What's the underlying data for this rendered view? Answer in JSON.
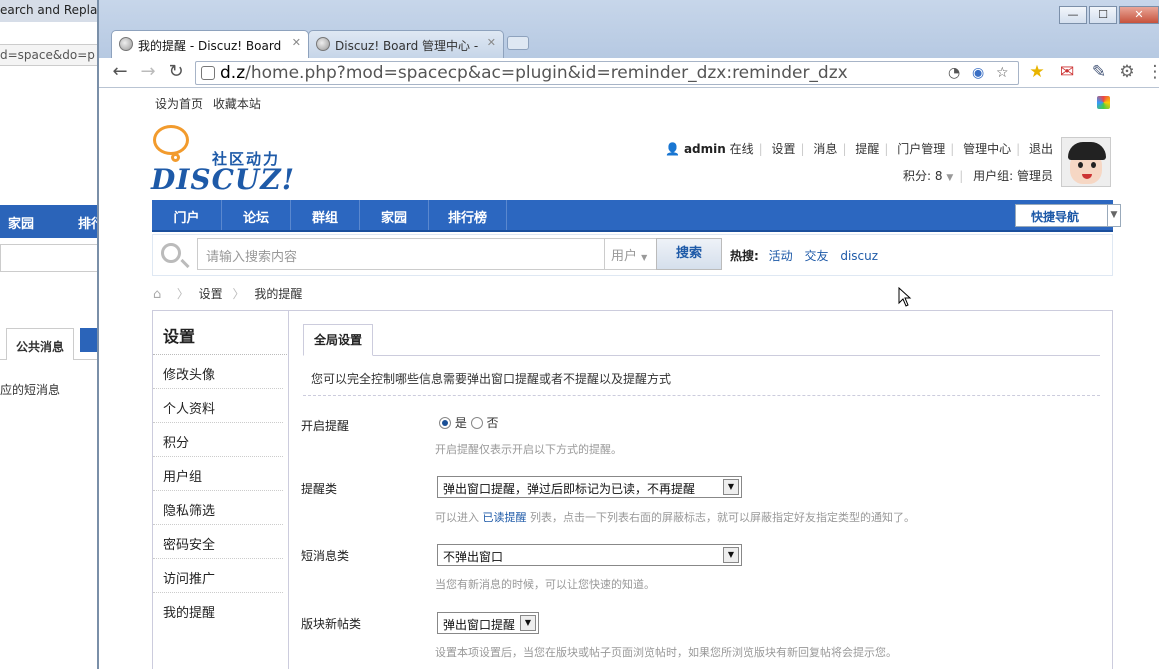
{
  "background_window": {
    "title": "earch and Replac",
    "url": "d=space&do=p",
    "nav_items": [
      "家园",
      "排行"
    ],
    "tab_label": "公共消息",
    "body_text": "应的短消息"
  },
  "browser": {
    "tabs": [
      {
        "label": "我的提醒 - Discuz! Board",
        "close": "✕"
      },
      {
        "label": "Discuz! Board 管理中心 -",
        "close": "✕"
      }
    ],
    "url_host": "d.z",
    "url_path": "/home.php?mod=spacecp&ac=plugin&id=reminder_dzx:reminder_dzx",
    "window_controls": [
      "—",
      "☐",
      "✕"
    ]
  },
  "topbar": {
    "set_home": "设为首页",
    "bookmark": "收藏本站"
  },
  "logo": {
    "tagline": "社区动力",
    "wordmark": "DISCUZ!"
  },
  "user": {
    "name": "admin",
    "status": "在线",
    "links": [
      "设置",
      "消息",
      "提醒",
      "门户管理",
      "管理中心",
      "退出"
    ],
    "credits_label": "积分: 8",
    "group_label": "用户组: 管理员"
  },
  "mainnav": {
    "items": [
      "门户",
      "论坛",
      "群组",
      "家园",
      "排行榜"
    ],
    "quick_nav": "快捷导航"
  },
  "search": {
    "placeholder": "请输入搜索内容",
    "type": "用户",
    "button": "搜索",
    "hot_label": "热搜:",
    "hot_terms": [
      "活动",
      "交友",
      "discuz"
    ]
  },
  "breadcrumb": {
    "items": [
      "设置",
      "我的提醒"
    ]
  },
  "sidebar": {
    "title": "设置",
    "items": [
      "修改头像",
      "个人资料",
      "积分",
      "用户组",
      "隐私筛选",
      "密码安全",
      "访问推广",
      "我的提醒"
    ],
    "active": "我的提醒"
  },
  "content": {
    "tab": "全局设置",
    "description": "您可以完全控制哪些信息需要弹出窗口提醒或者不提醒以及提醒方式",
    "fields": [
      {
        "label": "开启提醒",
        "options": [
          "是",
          "否"
        ],
        "selected": "是",
        "hint": "开启提醒仅表示开启以下方式的提醒。"
      },
      {
        "label": "提醒类",
        "value": "弹出窗口提醒，弹过后即标记为已读，不再提醒",
        "hint_prefix": "可以进入",
        "hint_link": "已读提醒",
        "hint_suffix": "列表，点击一下列表右面的屏蔽标志，就可以屏蔽指定好友指定类型的通知了。"
      },
      {
        "label": "短消息类",
        "value": "不弹出窗口",
        "hint": "当您有新消息的时候，可以让您快速的知道。"
      },
      {
        "label": "版块新帖类",
        "value": "弹出窗口提醒",
        "hint": "设置本项设置后，当您在版块或帖子页面浏览帖时，如果您所浏览版块有新回复帖将会提示您。"
      }
    ]
  },
  "colors": {
    "nav_blue": "#2c67c0",
    "link_blue": "#1e5aa8",
    "logo_orange": "#f29b2d"
  }
}
